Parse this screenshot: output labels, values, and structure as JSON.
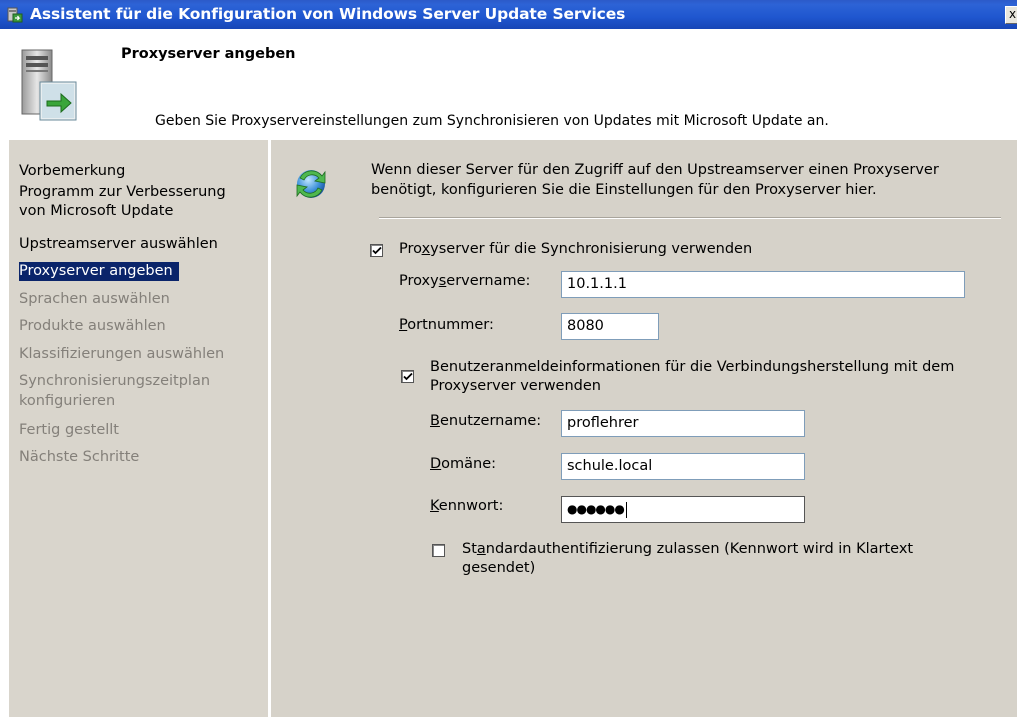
{
  "window": {
    "title": "Assistent für die Konfiguration von Windows Server Update Services",
    "close_glyph": "x"
  },
  "header": {
    "title": "Proxyserver angeben",
    "subtitle": "Geben Sie Proxyservereinstellungen zum Synchronisieren von Updates mit Microsoft Update an."
  },
  "nav": {
    "items": [
      {
        "label": "Vorbemerkung",
        "state": "done"
      },
      {
        "label": "Programm zur Verbesserung",
        "state": "done"
      },
      {
        "label": "von Microsoft Update",
        "state": "done"
      },
      {
        "label": "Upstreamserver auswählen",
        "state": "done"
      },
      {
        "label": "Proxyserver angeben",
        "state": "selected"
      },
      {
        "label": "Sprachen auswählen",
        "state": "disabled"
      },
      {
        "label": "Produkte auswählen",
        "state": "disabled"
      },
      {
        "label": "Klassifizierungen auswählen",
        "state": "disabled"
      },
      {
        "label": "Synchronisierungszeitplan",
        "state": "disabled"
      },
      {
        "label": "konfigurieren",
        "state": "disabled"
      },
      {
        "label": "Fertig gestellt",
        "state": "disabled"
      },
      {
        "label": "Nächste Schritte",
        "state": "disabled"
      }
    ]
  },
  "content": {
    "intro_icon": "sync-icon",
    "intro_line1": "Wenn dieser Server für den Zugriff auf den Upstreamserver einen Proxyserver",
    "intro_line2": "benötigt, konfigurieren Sie die Einstellungen für den Proxyserver hier.",
    "use_proxy": {
      "checked": true,
      "label_pre": "Pro",
      "label_acc": "x",
      "label_post": "yserver für die Synchronisierung verwenden"
    },
    "proxy_name": {
      "label_pre": "Proxy",
      "label_acc": "s",
      "label_post": "ervername:",
      "value": "10.1.1.1"
    },
    "port": {
      "label_acc": "P",
      "label_post": "ortnummer:",
      "value": "8080"
    },
    "use_credentials": {
      "checked": true,
      "line1": "Benutzeranmeldeinformationen für die Verbindungsherstellung mit dem",
      "line2": "Proxyserver verwenden"
    },
    "username": {
      "label_acc": "B",
      "label_post": "enutzername:",
      "value": "proflehrer"
    },
    "domain": {
      "label_acc": "D",
      "label_post": "omäne:",
      "value": "schule.local"
    },
    "password": {
      "label_acc": "K",
      "label_post": "ennwort:",
      "value": "●●●●●●"
    },
    "basic_auth": {
      "checked": false,
      "line1_pre": "St",
      "line1_acc": "a",
      "line1_post": "ndardauthentifizierung zulassen (Kennwort wird in Klartext",
      "line2": "gesendet)"
    }
  }
}
